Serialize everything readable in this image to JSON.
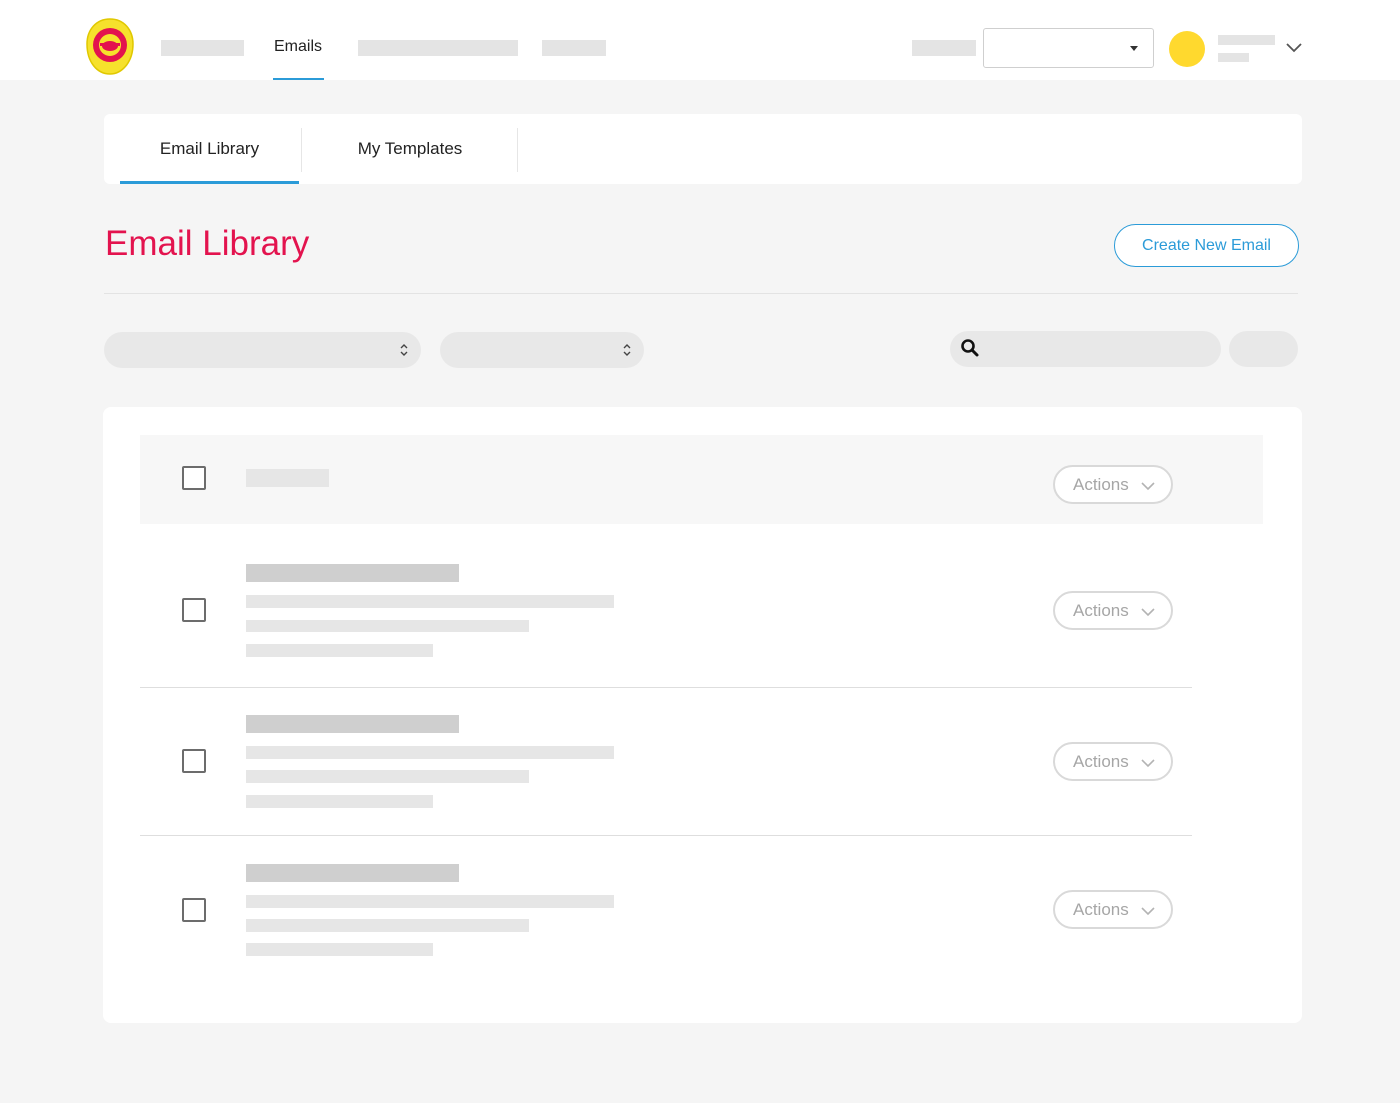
{
  "nav": {
    "active_item": "Emails"
  },
  "tabs": [
    {
      "label": "Email Library",
      "active": true
    },
    {
      "label": "My Templates",
      "active": false
    }
  ],
  "page": {
    "title": "Email Library",
    "create_button": "Create New Email"
  },
  "list": {
    "header_actions": "Actions",
    "rows": [
      {
        "actions_label": "Actions"
      },
      {
        "actions_label": "Actions"
      },
      {
        "actions_label": "Actions"
      }
    ]
  },
  "colors": {
    "accent_blue": "#2b9bd8",
    "title_red": "#e3134e",
    "avatar_yellow": "#ffd92e",
    "logo_yellow": "#f6e12c",
    "logo_red": "#e3134e"
  },
  "icons": [
    "logo-icon",
    "dropdown-caret-icon",
    "chevron-down-icon",
    "search-icon",
    "sort-updown-icon"
  ]
}
